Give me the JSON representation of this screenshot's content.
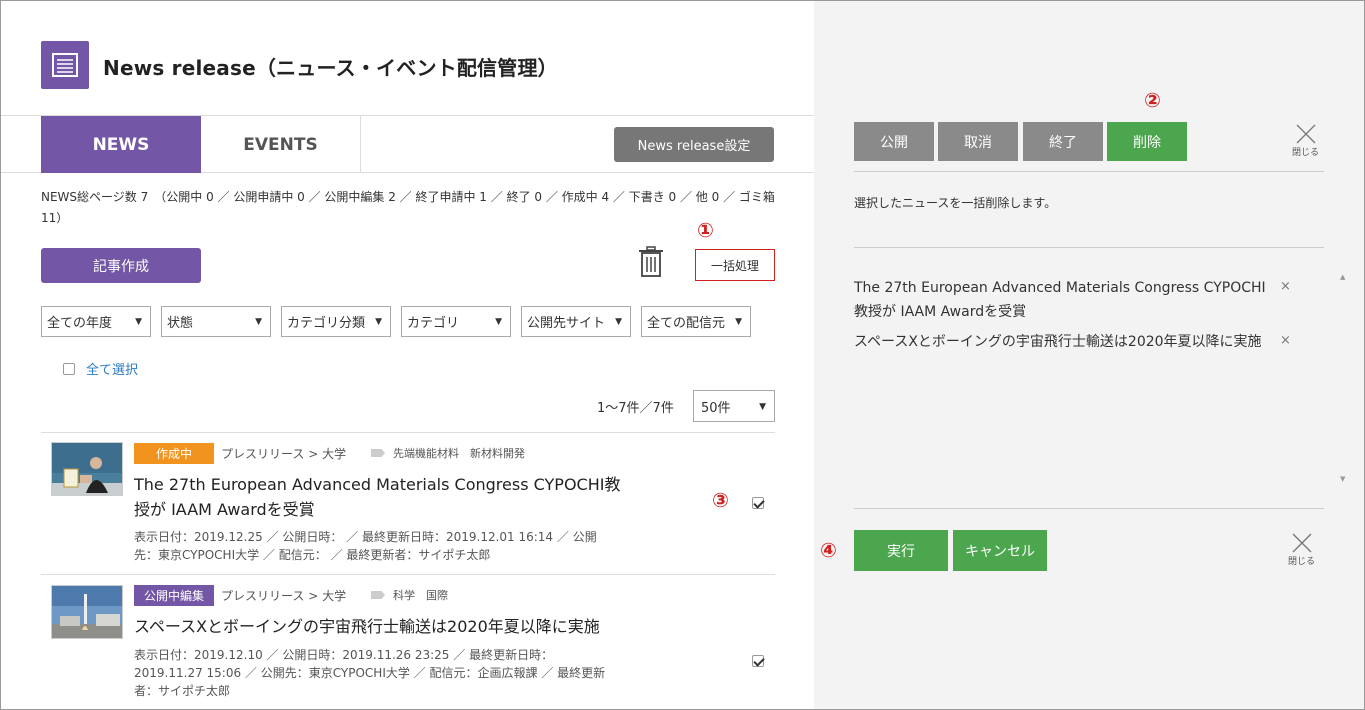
{
  "header": {
    "title": "News release（ニュース・イベント配信管理）",
    "icon": "document-list-icon"
  },
  "tabs": [
    {
      "label": "NEWS",
      "active": true
    },
    {
      "label": "EVENTS",
      "active": false
    }
  ],
  "settings_button": "News release設定",
  "summary": "NEWS総ページ数 7　（公開中 0 ／ 公開申請中 0 ／ 公開中編集 2 ／ 終了申請中 1 ／ 終了 0 ／ 作成中 4 ／ 下書き 0 ／ 他 0 ／ ゴミ箱 11）",
  "create_button": "記事作成",
  "bulk_button": "一括処理",
  "markers": {
    "m1": "①",
    "m2": "②",
    "m3": "③",
    "m4": "④"
  },
  "filters": [
    {
      "value": "全ての年度"
    },
    {
      "value": "状態"
    },
    {
      "value": "カテゴリ分類"
    },
    {
      "value": "カテゴリ"
    },
    {
      "value": "公開先サイト"
    },
    {
      "value": "全ての配信元"
    }
  ],
  "select_all": "全て選択",
  "pagination": {
    "range": "1〜7件／7件",
    "per_page": "50件"
  },
  "items": [
    {
      "status": "作成中",
      "status_color": "#f0941f",
      "crumb": "プレスリリース > 大学",
      "tags": "先端機能材料　新材料開発",
      "title": "The 27th European Advanced Materials Congress CYPOCHI教授が IAAM Awardを受賞",
      "meta": "表示日付：2019.12.25 ／ 公開日時： ／ 最終更新日時：2019.12.01 16:14 ／ 公開先：東京CYPOCHI大学 ／ 配信元： ／ 最終更新者：サイポチ太郎",
      "checked": true
    },
    {
      "status": "公開中編集",
      "status_color": "#7356a5",
      "crumb": "プレスリリース > 大学",
      "tags": "科学　国際",
      "title": "スペースXとボーイングの宇宙飛行士輸送は2020年夏以降に実施",
      "meta": "表示日付：2019.12.10 ／ 公開日時：2019.11.26 23:25 ／ 最終更新日時：2019.11.27 15:06 ／ 公開先：東京CYPOCHI大学 ／ 配信元：企画広報課 ／ 最終更新者：サイポチ太郎",
      "checked": true
    }
  ],
  "panel": {
    "actions": [
      "公開",
      "取消",
      "終了",
      "削除"
    ],
    "active_action": "削除",
    "close_label": "閉じる",
    "description": "選択したニュースを一括削除します。",
    "selected": [
      "The 27th European Advanced Materials Congress CYPOCHI教授が IAAM Awardを受賞",
      "スペースXとボーイングの宇宙飛行士輸送は2020年夏以降に実施"
    ],
    "remove_icon": "×",
    "execute_button": "実行",
    "cancel_button": "キャンセル"
  },
  "colors": {
    "accent": "#7356a5",
    "green": "#4ba64e",
    "gray": "#8a8a8a",
    "red": "#d21f1f",
    "orange": "#f0941f"
  }
}
